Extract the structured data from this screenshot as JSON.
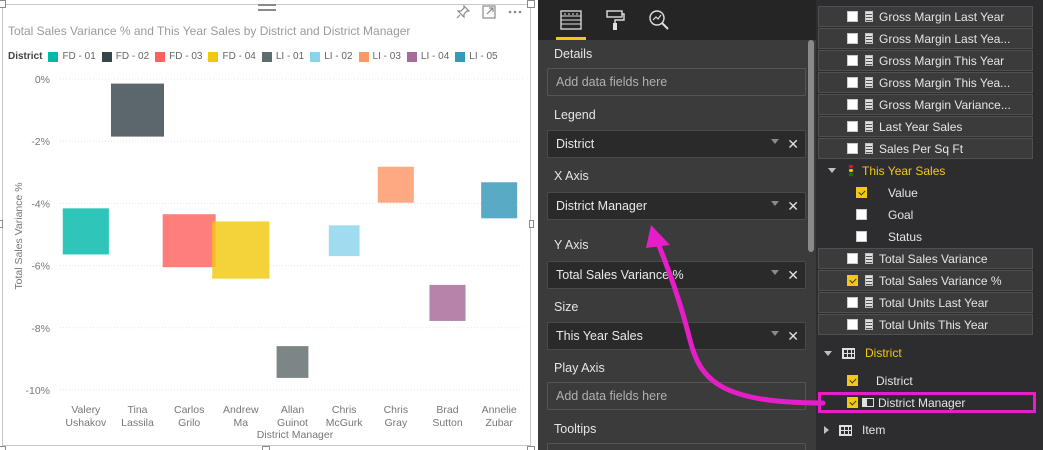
{
  "visual": {
    "title": "Total Sales Variance % and This Year Sales by District and District Manager",
    "icons": [
      "pin-icon",
      "focus-mode-icon",
      "more-options-icon"
    ]
  },
  "legend": {
    "title": "District",
    "items": [
      {
        "label": "FD - 01",
        "color": "#01b8aa"
      },
      {
        "label": "FD - 02",
        "color": "#374649"
      },
      {
        "label": "FD - 03",
        "color": "#fd625e"
      },
      {
        "label": "FD - 04",
        "color": "#f2c80f"
      },
      {
        "label": "LI - 01",
        "color": "#5f6b6d"
      },
      {
        "label": "LI - 02",
        "color": "#8ad4eb"
      },
      {
        "label": "LI - 03",
        "color": "#fe9666"
      },
      {
        "label": "LI - 04",
        "color": "#a66999"
      },
      {
        "label": "LI - 05",
        "color": "#3599b8"
      }
    ]
  },
  "chart_data": {
    "type": "scatter",
    "title": "Total Sales Variance % and This Year Sales by District and District Manager",
    "xlabel": "District Manager",
    "ylabel": "Total Sales Variance %",
    "categories": [
      "Valery Ushakov",
      "Tina Lassila",
      "Carlos Grilo",
      "Andrew Ma",
      "Allan Guinot",
      "Chris McGurk",
      "Chris Gray",
      "Brad Sutton",
      "Annelie Zubar"
    ],
    "category_lines": [
      [
        "Valery",
        "Ushakov"
      ],
      [
        "Tina",
        "Lassila"
      ],
      [
        "Carlos",
        "Grilo"
      ],
      [
        "Andrew",
        "Ma"
      ],
      [
        "Allan",
        "Guinot"
      ],
      [
        "Chris",
        "McGurk"
      ],
      [
        "Chris",
        "Gray"
      ],
      [
        "Brad",
        "Sutton"
      ],
      [
        "Annelie",
        "Zubar"
      ]
    ],
    "yticks": [
      "0%",
      "-2%",
      "-4%",
      "-6%",
      "-8%",
      "-10%"
    ],
    "ylim": [
      -10,
      0
    ],
    "grid": true,
    "series": [
      {
        "name": "FD - 01",
        "x": "Valery Ushakov",
        "y": -4.9,
        "size": 0.87
      },
      {
        "name": "FD - 02",
        "x": "Tina Lassila",
        "y": -1.0,
        "size": 1.0
      },
      {
        "name": "FD - 03",
        "x": "Carlos Grilo",
        "y": -5.2,
        "size": 1.0
      },
      {
        "name": "FD - 04",
        "x": "Andrew Ma",
        "y": -5.5,
        "size": 1.08
      },
      {
        "name": "LI - 01",
        "x": "Allan Guinot",
        "y": -9.1,
        "size": 0.6
      },
      {
        "name": "LI - 02",
        "x": "Chris McGurk",
        "y": -5.2,
        "size": 0.58
      },
      {
        "name": "LI - 03",
        "x": "Chris Gray",
        "y": -3.4,
        "size": 0.68
      },
      {
        "name": "LI - 04",
        "x": "Brad Sutton",
        "y": -7.2,
        "size": 0.68
      },
      {
        "name": "LI - 05",
        "x": "Annelie Zubar",
        "y": -3.9,
        "size": 0.68
      }
    ]
  },
  "viz_pane": {
    "tabs": [
      {
        "name": "fields-tab-icon",
        "active": true
      },
      {
        "name": "format-paint-roller-icon",
        "active": false
      },
      {
        "name": "analytics-magnifier-icon",
        "active": false
      }
    ],
    "wells": [
      {
        "label": "Details",
        "value": "Add data fields here",
        "filled": false
      },
      {
        "label": "Legend",
        "value": "District",
        "filled": true
      },
      {
        "label": "X Axis",
        "value": "District Manager",
        "filled": true
      },
      {
        "label": "Y Axis",
        "value": "Total Sales Variance %",
        "filled": true
      },
      {
        "label": "Size",
        "value": "This Year Sales",
        "filled": true
      },
      {
        "label": "Play Axis",
        "value": "Add data fields here",
        "filled": false
      },
      {
        "label": "Tooltips",
        "value": "",
        "filled": false
      }
    ]
  },
  "fields_pane": {
    "items": [
      {
        "label": "Gross Margin Last Year",
        "kind": "measure",
        "checked": false
      },
      {
        "label": "Gross Margin Last Yea...",
        "kind": "measure",
        "checked": false
      },
      {
        "label": "Gross Margin This Year",
        "kind": "measure",
        "checked": false
      },
      {
        "label": "Gross Margin This Yea...",
        "kind": "measure",
        "checked": false
      },
      {
        "label": "Gross Margin Variance...",
        "kind": "measure",
        "checked": false
      },
      {
        "label": "Last Year Sales",
        "kind": "measure",
        "checked": false
      },
      {
        "label": "Sales Per Sq Ft",
        "kind": "measure",
        "checked": false
      },
      {
        "label": "This Year Sales",
        "kind": "kpi",
        "checked": false
      },
      {
        "label": "Value",
        "kind": "kpi-sub",
        "checked": true
      },
      {
        "label": "Goal",
        "kind": "kpi-sub",
        "checked": false
      },
      {
        "label": "Status",
        "kind": "kpi-sub",
        "checked": false
      },
      {
        "label": "Total Sales Variance",
        "kind": "measure",
        "checked": false
      },
      {
        "label": "Total Sales Variance %",
        "kind": "measure",
        "checked": true
      },
      {
        "label": "Total Units Last Year",
        "kind": "measure",
        "checked": false
      },
      {
        "label": "Total Units This Year",
        "kind": "measure",
        "checked": false
      }
    ],
    "tables": [
      {
        "label": "District",
        "expanded": true,
        "fields": [
          {
            "label": "District",
            "checked": true
          },
          {
            "label": "District Manager",
            "checked": true
          }
        ]
      },
      {
        "label": "Item",
        "expanded": false,
        "fields": []
      }
    ]
  },
  "colors": {
    "accent": "#f2c811",
    "highlight": "#e61ec8"
  }
}
